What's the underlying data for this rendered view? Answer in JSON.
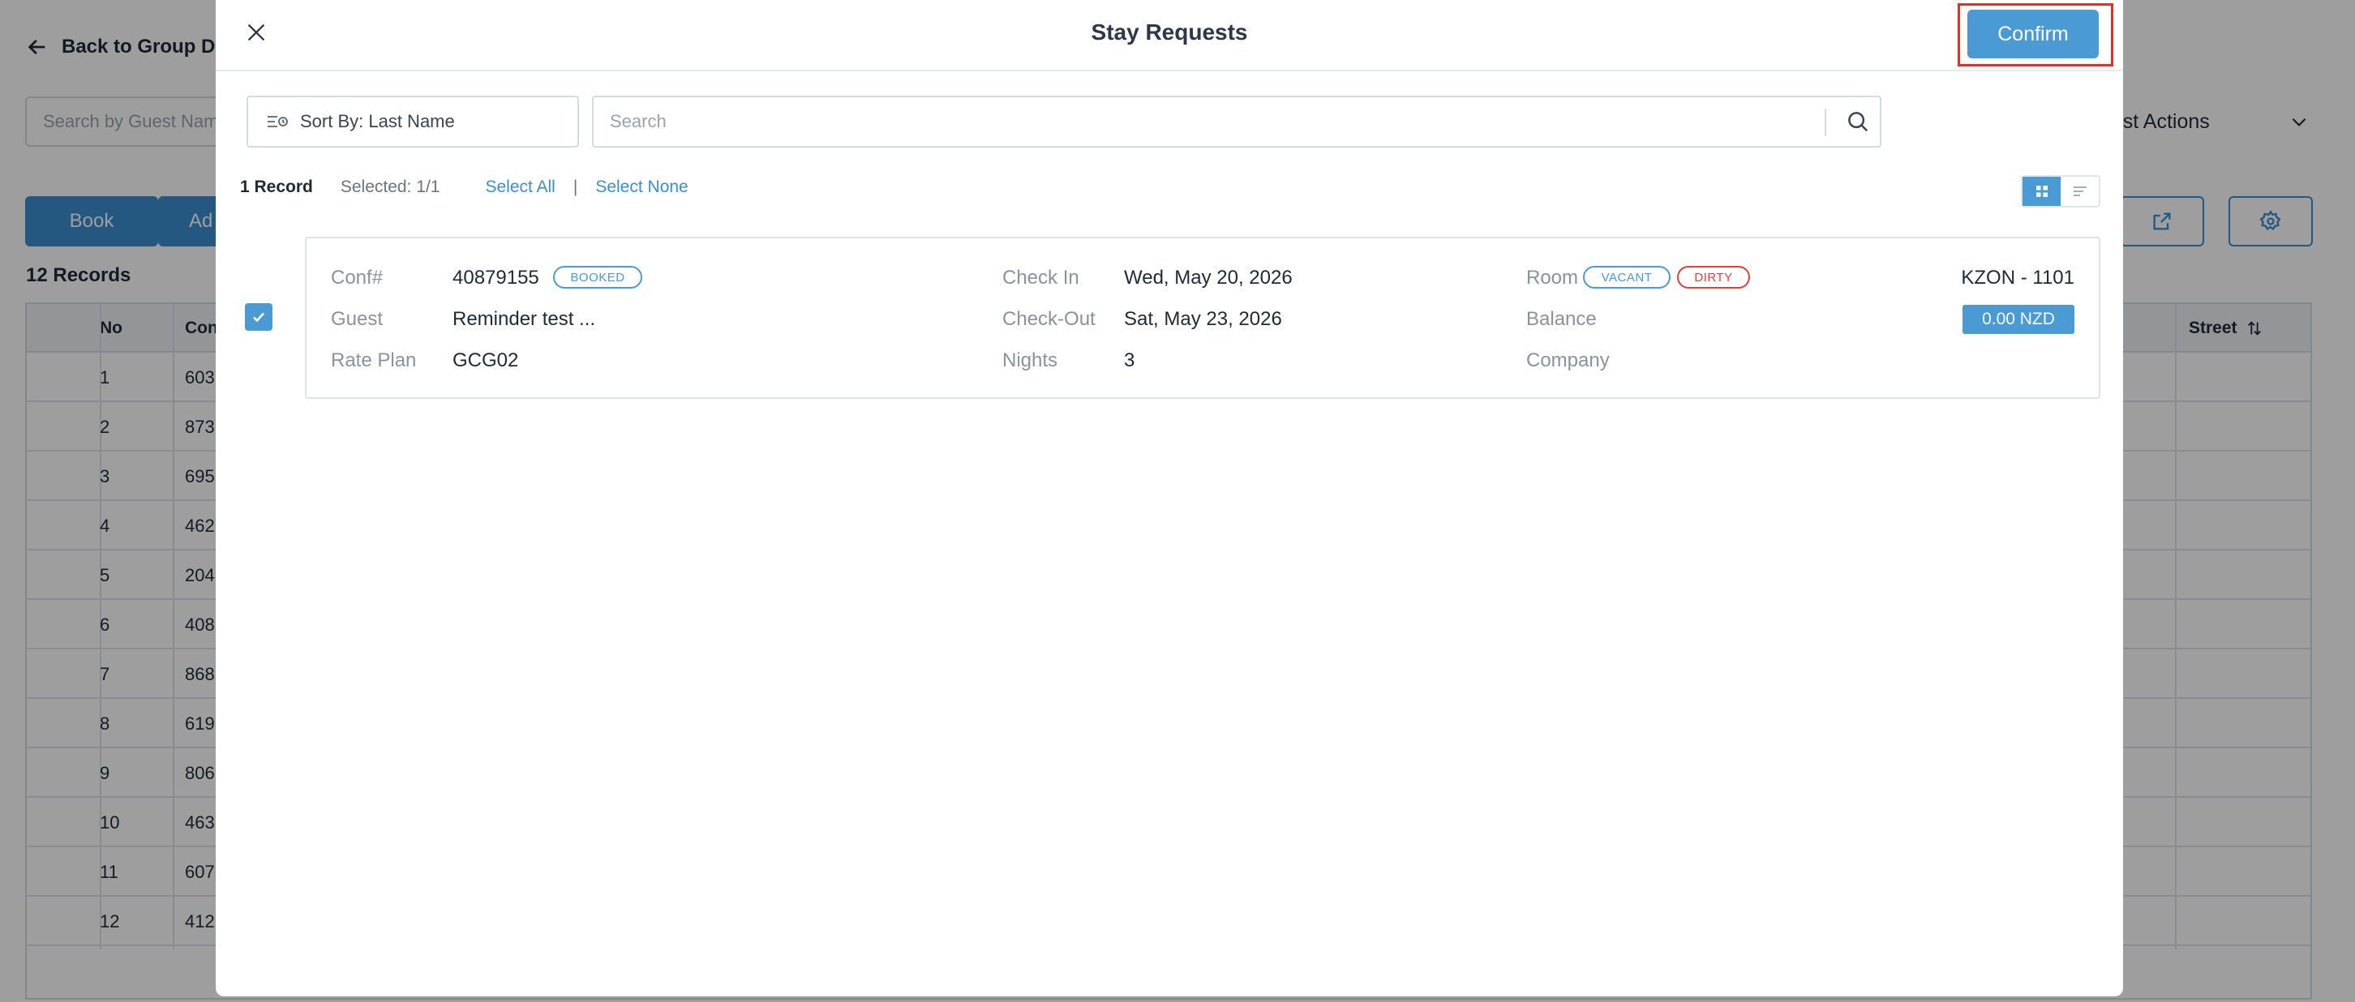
{
  "background": {
    "back_label": "Back to Group De",
    "search_placeholder": "Search by Guest Name",
    "actions_label": "ing List Actions",
    "book_label": "Book",
    "add_label": "Ad",
    "records_label": "12 Records",
    "columns": {
      "no": "No",
      "conf": "Con",
      "street": "Street"
    },
    "rows": [
      {
        "no": "1",
        "conf": "603"
      },
      {
        "no": "2",
        "conf": "873"
      },
      {
        "no": "3",
        "conf": "695"
      },
      {
        "no": "4",
        "conf": "462"
      },
      {
        "no": "5",
        "conf": "204"
      },
      {
        "no": "6",
        "conf": "408"
      },
      {
        "no": "7",
        "conf": "868"
      },
      {
        "no": "8",
        "conf": "619"
      },
      {
        "no": "9",
        "conf": "806"
      },
      {
        "no": "10",
        "conf": "463"
      },
      {
        "no": "11",
        "conf": "607"
      },
      {
        "no": "12",
        "conf": "412"
      }
    ]
  },
  "modal": {
    "title": "Stay Requests",
    "confirm_label": "Confirm",
    "sort_label": "Sort By: Last Name",
    "search_placeholder": "Search",
    "record_count": "1 Record",
    "selected": "Selected: 1/1",
    "select_all": "Select All",
    "separator": "|",
    "select_none": "Select None",
    "view_mode": "grid"
  },
  "reservation": {
    "checked": true,
    "conf_label": "Conf#",
    "conf_value": "40879155",
    "status_badge": "BOOKED",
    "guest_label": "Guest",
    "guest_value": "Reminder test ...",
    "rate_plan_label": "Rate Plan",
    "rate_plan_value": "GCG02",
    "check_in_label": "Check In",
    "check_in_value": "Wed, May 20, 2026",
    "check_out_label": "Check-Out",
    "check_out_value": "Sat, May 23, 2026",
    "nights_label": "Nights",
    "nights_value": "3",
    "room_label": "Room",
    "room_status_1": "VACANT",
    "room_status_2": "DIRTY",
    "room_value": "KZON - 1101",
    "balance_label": "Balance",
    "balance_value": "0.00 NZD",
    "company_label": "Company"
  },
  "colors": {
    "accent": "#4a9bd4",
    "highlight_outline": "#e0302a",
    "dirty": "#e0403a",
    "overlay": "rgba(0,0,0,0.38)"
  }
}
